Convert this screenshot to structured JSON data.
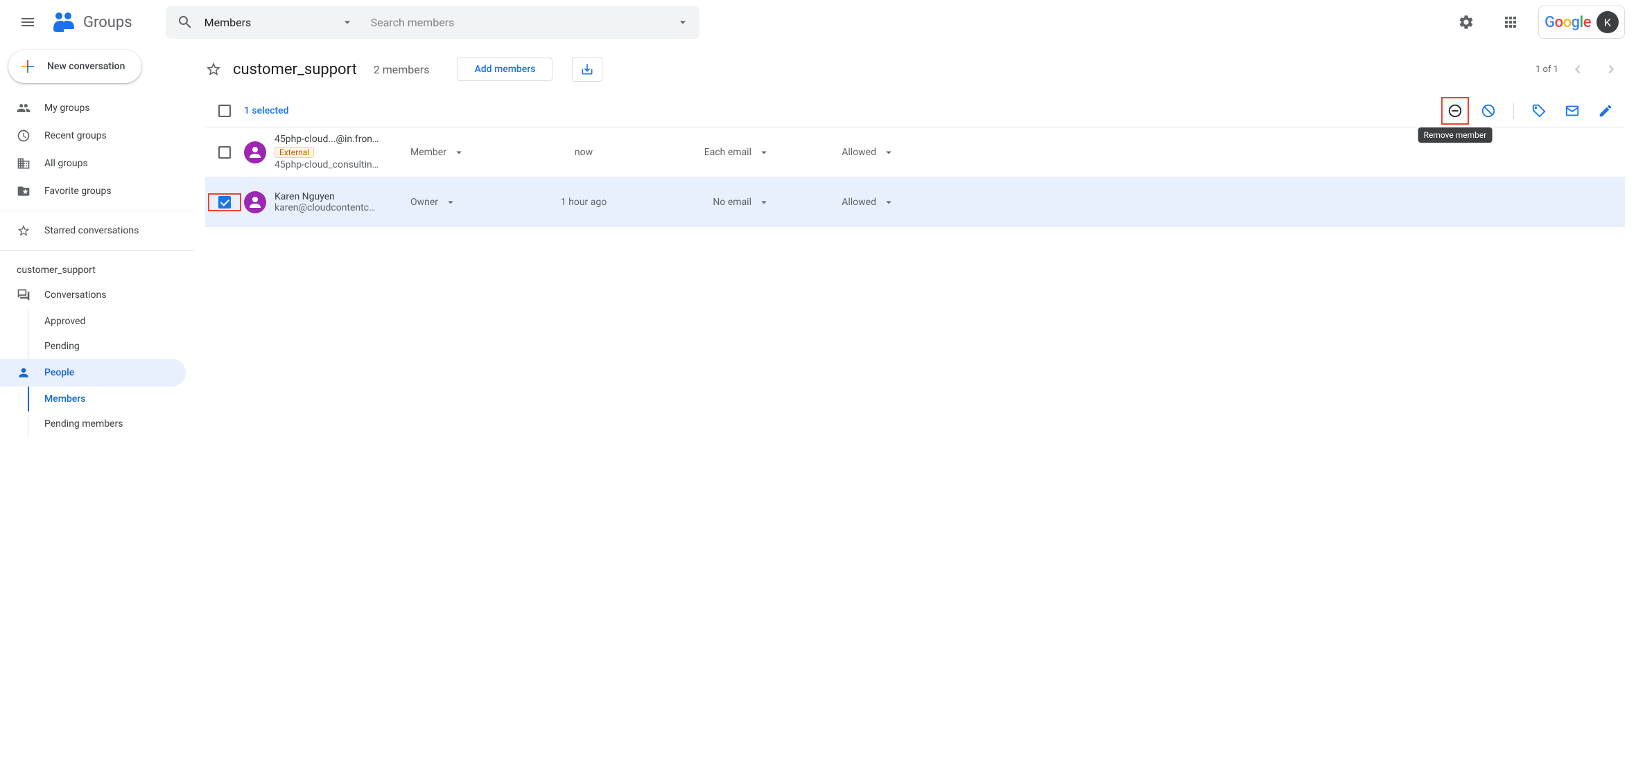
{
  "app": {
    "name": "Groups",
    "avatar_letter": "K"
  },
  "search": {
    "type_label": "Members",
    "placeholder": "Search members"
  },
  "sidebar": {
    "new_conversation": "New conversation",
    "nav": {
      "my_groups": "My groups",
      "recent_groups": "Recent groups",
      "all_groups": "All groups",
      "favorite_groups": "Favorite groups",
      "starred": "Starred conversations"
    },
    "group_section": "customer_support",
    "group_nav": {
      "conversations": "Conversations",
      "approved": "Approved",
      "pending": "Pending",
      "people": "People",
      "members": "Members",
      "pending_members": "Pending members"
    }
  },
  "page": {
    "title": "customer_support",
    "member_count": "2 members",
    "add_members": "Add members",
    "pagination": "1 of 1"
  },
  "toolbar": {
    "selected_text": "1 selected",
    "tooltip_remove": "Remove member"
  },
  "members": [
    {
      "name": "45php-cloud...@in.fron…",
      "email": "45php-cloud_consultin…",
      "external": "External",
      "role": "Member",
      "join": "now",
      "subscription": "Each email",
      "posting": "Allowed",
      "checked": false
    },
    {
      "name": "Karen Nguyen",
      "email": "karen@cloudcontentc…",
      "external": null,
      "role": "Owner",
      "join": "1 hour ago",
      "subscription": "No email",
      "posting": "Allowed",
      "checked": true
    }
  ]
}
